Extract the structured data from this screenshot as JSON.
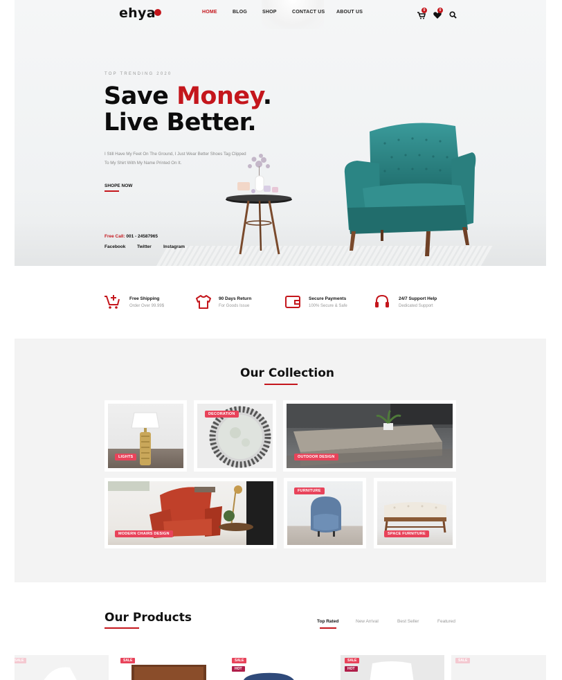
{
  "header": {
    "logo": "ehya",
    "nav": [
      "HOME",
      "BLOG",
      "SHOP",
      "CONTACT US",
      "ABOUT US"
    ],
    "active_nav": "HOME",
    "cart_count": "0",
    "wishlist_count": "0",
    "icons": [
      "cart-icon",
      "heart-icon",
      "search-icon"
    ]
  },
  "hero": {
    "kicker": "TOP TRENDING 2020",
    "title_line1_a": "Save ",
    "title_line1_b": "Money",
    "title_line1_c": ".",
    "title_line2": "Live Better.",
    "lead_line1": "I Still Have My Feet On The Ground, I Just Wear Better Shoes Tag Clipped",
    "lead_line2": "To My Shirt With My Name Printed On It.",
    "cta": "SHOPE NOW",
    "call_label": "Free Call:",
    "call_number": " 001 - 24587965",
    "social": [
      "Facebook",
      "Twitter",
      "Instagram"
    ]
  },
  "features": [
    {
      "title": "Free Shipping",
      "subtitle": "Order Over 99.99$",
      "icon": "cart-plus-icon"
    },
    {
      "title": "90 Days Return",
      "subtitle": "For Goods Issue",
      "icon": "tshirt-icon"
    },
    {
      "title": "Secure Payments",
      "subtitle": "100% Secure & Safe",
      "icon": "wallet-icon"
    },
    {
      "title": "24/7 Support Help",
      "subtitle": "Dedicated Support",
      "icon": "headset-icon"
    }
  ],
  "collection": {
    "title": "Our Collection",
    "items": [
      "LIGHTS",
      "DECORATION",
      "OUTDOOR DESIGN",
      "MODERN CHAIRS DESIGN",
      "FURNITURE",
      "SPACE FURNITURE"
    ]
  },
  "products": {
    "title": "Our Products",
    "tabs": [
      "Top Rated",
      "New Arrival",
      "Best Seller",
      "Featured"
    ],
    "active_tab": "Top Rated",
    "badges": {
      "sale": "SALE",
      "hot": "HOT"
    }
  },
  "colors": {
    "accent": "#c4161c",
    "tag": "#e8435a",
    "section_bg": "#f3f3f3"
  }
}
